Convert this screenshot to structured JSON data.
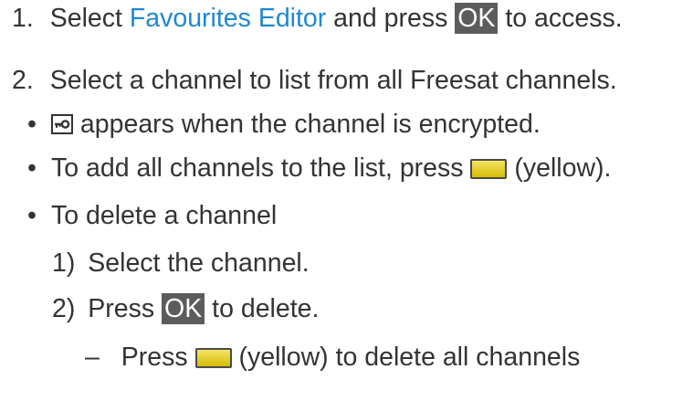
{
  "step1": {
    "number": "1.",
    "text_a": "Select ",
    "link": "Favourites Editor",
    "text_b": " and press ",
    "key": "OK",
    "text_c": " to access."
  },
  "step2": {
    "number": "2.",
    "text": "Select a channel to list from all Freesat channels."
  },
  "bullets": {
    "encrypted": "appears when the channel is encrypted.",
    "add_all_a": "To add all channels to the list, press ",
    "add_all_b": " (yellow).",
    "delete": "To delete a channel"
  },
  "substeps": {
    "s1_number": "1)",
    "s1_text": "Select the channel.",
    "s2_number": "2)",
    "s2_a": "Press ",
    "s2_key": "OK",
    "s2_b": " to delete."
  },
  "dash_item": {
    "dash": "–",
    "a": "Press ",
    "b": " (yellow) to delete all channels"
  },
  "colors": {
    "link": "#1e88d4",
    "ok_key_bg": "#5c5c5c",
    "yellow_button": "#e6d030",
    "text": "#333333"
  },
  "icons": [
    "key-icon",
    "yellow-button-icon"
  ]
}
